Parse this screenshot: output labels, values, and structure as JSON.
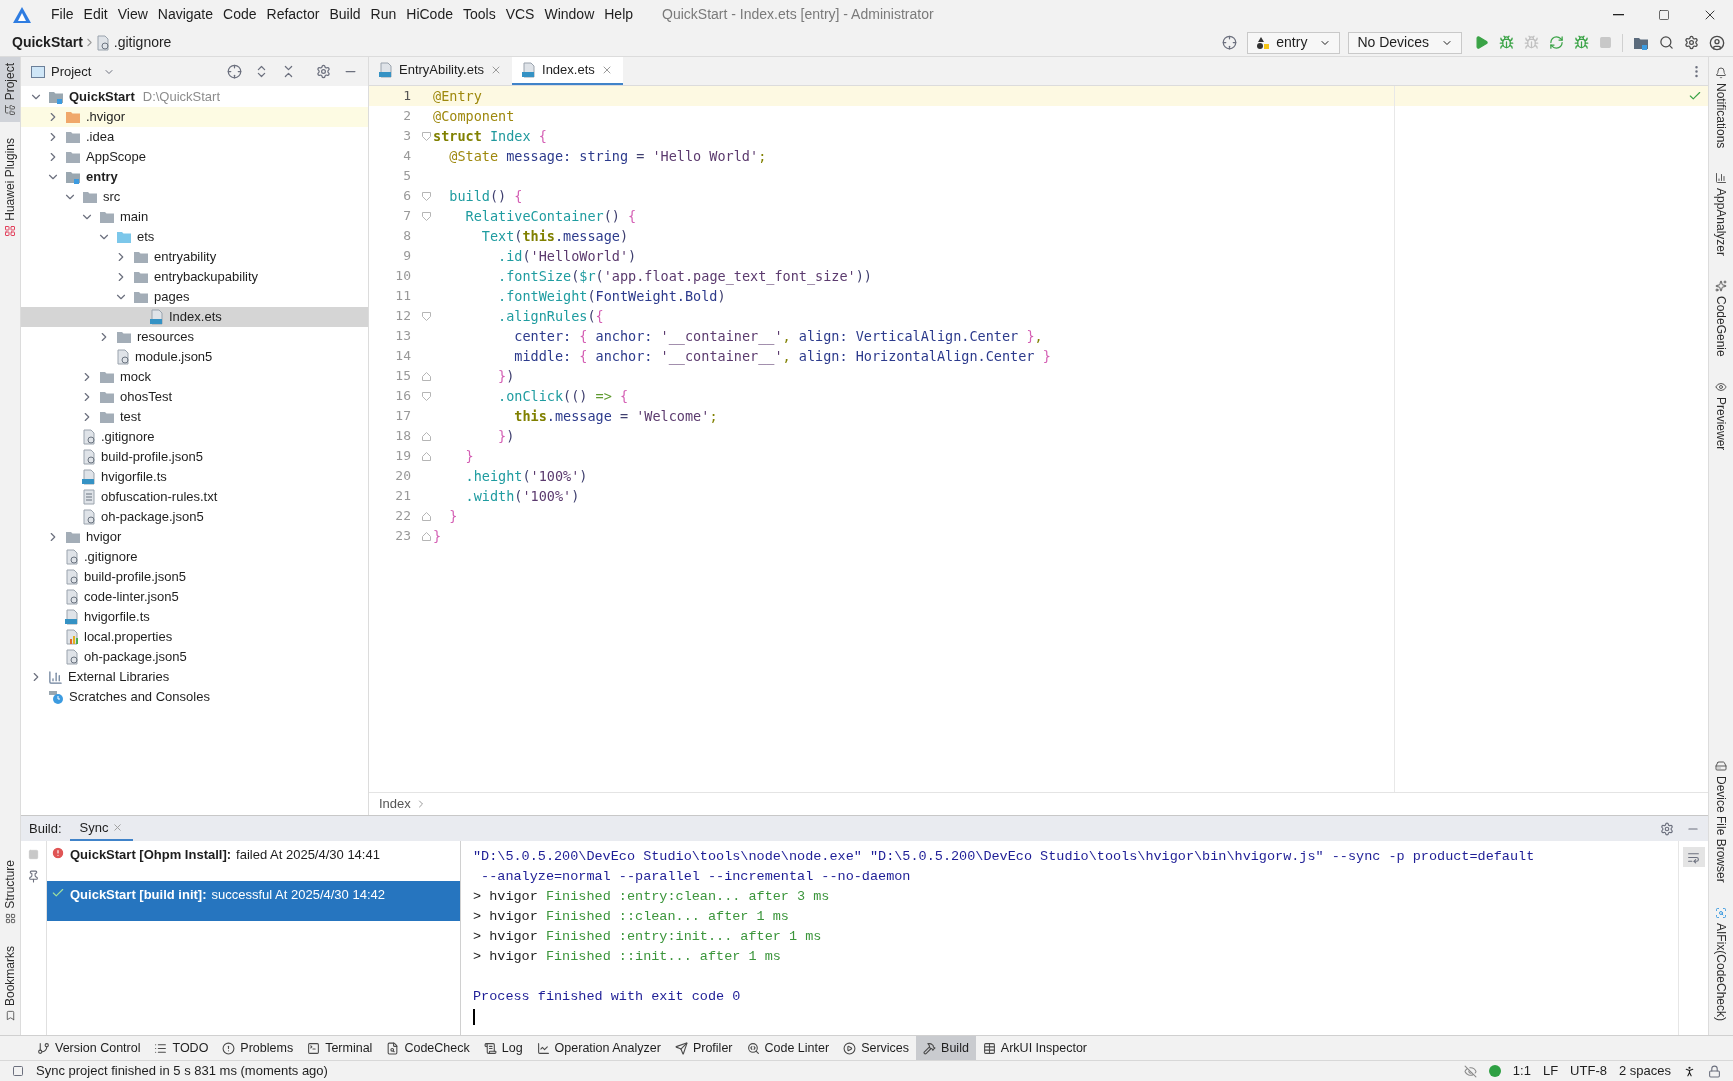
{
  "window": {
    "title": "QuickStart - Index.ets [entry] - Administrator"
  },
  "menu": [
    "File",
    "Edit",
    "View",
    "Navigate",
    "Code",
    "Refactor",
    "Build",
    "Run",
    "HiCode",
    "Tools",
    "VCS",
    "Window",
    "Help"
  ],
  "navbar": {
    "project": "QuickStart",
    "file": ".gitignore",
    "module_selector": "entry",
    "device_selector": "No Devices"
  },
  "left_stripe": {
    "top": [
      {
        "label": "Project",
        "selected": true
      },
      {
        "label": "Huawei Plugins",
        "selected": false
      }
    ],
    "bottom": [
      {
        "label": "Structure",
        "selected": false
      },
      {
        "label": "Bookmarks",
        "selected": false
      }
    ]
  },
  "right_stripe": {
    "top": [
      "Notifications",
      "AppAnalyzer",
      "CodeGenie",
      "Previewer"
    ],
    "bottom": [
      "Device File Browser",
      "AIFix(CodeCheck)"
    ]
  },
  "project_panel": {
    "title": "Project",
    "tree": [
      {
        "label": "QuickStart",
        "path": "D:\\QuickStart",
        "kind": "module",
        "expanded": true,
        "selected": false,
        "highlighted": false,
        "children": [
          {
            "label": ".hvigor",
            "kind": "folder-excluded",
            "expanded": false,
            "selected": false,
            "highlighted": true
          },
          {
            "label": ".idea",
            "kind": "folder",
            "expanded": false,
            "selected": false,
            "highlighted": false
          },
          {
            "label": "AppScope",
            "kind": "folder",
            "expanded": false,
            "selected": false,
            "highlighted": false
          },
          {
            "label": "entry",
            "kind": "module",
            "expanded": true,
            "selected": false,
            "highlighted": false,
            "children": [
              {
                "label": "src",
                "kind": "folder",
                "expanded": true,
                "selected": false,
                "highlighted": false,
                "children": [
                  {
                    "label": "main",
                    "kind": "folder",
                    "expanded": true,
                    "selected": false,
                    "highlighted": false,
                    "children": [
                      {
                        "label": "ets",
                        "kind": "folder-source",
                        "expanded": true,
                        "selected": false,
                        "highlighted": false,
                        "children": [
                          {
                            "label": "entryability",
                            "kind": "folder",
                            "expanded": false,
                            "selected": false,
                            "highlighted": false
                          },
                          {
                            "label": "entrybackupability",
                            "kind": "folder",
                            "expanded": false,
                            "selected": false,
                            "highlighted": false
                          },
                          {
                            "label": "pages",
                            "kind": "folder",
                            "expanded": true,
                            "selected": false,
                            "highlighted": false,
                            "children": [
                              {
                                "label": "Index.ets",
                                "kind": "file-ets",
                                "selected": true,
                                "highlighted": false
                              }
                            ]
                          }
                        ]
                      },
                      {
                        "label": "resources",
                        "kind": "folder",
                        "expanded": false,
                        "selected": false,
                        "highlighted": false
                      },
                      {
                        "label": "module.json5",
                        "kind": "file-json",
                        "selected": false,
                        "highlighted": false
                      }
                    ]
                  },
                  {
                    "label": "mock",
                    "kind": "folder",
                    "expanded": false,
                    "selected": false,
                    "highlighted": false
                  },
                  {
                    "label": "ohosTest",
                    "kind": "folder",
                    "expanded": false,
                    "selected": false,
                    "highlighted": false
                  },
                  {
                    "label": "test",
                    "kind": "folder",
                    "expanded": false,
                    "selected": false,
                    "highlighted": false
                  }
                ]
              },
              {
                "label": ".gitignore",
                "kind": "file-ignore",
                "selected": false,
                "highlighted": false
              },
              {
                "label": "build-profile.json5",
                "kind": "file-json",
                "selected": false,
                "highlighted": false
              },
              {
                "label": "hvigorfile.ts",
                "kind": "file-ts",
                "selected": false,
                "highlighted": false
              },
              {
                "label": "obfuscation-rules.txt",
                "kind": "file-text",
                "selected": false,
                "highlighted": false
              },
              {
                "label": "oh-package.json5",
                "kind": "file-json",
                "selected": false,
                "highlighted": false
              }
            ]
          },
          {
            "label": "hvigor",
            "kind": "folder",
            "expanded": false,
            "selected": false,
            "highlighted": false
          },
          {
            "label": ".gitignore",
            "kind": "file-ignore",
            "selected": false,
            "highlighted": false
          },
          {
            "label": "build-profile.json5",
            "kind": "file-json",
            "selected": false,
            "highlighted": false
          },
          {
            "label": "code-linter.json5",
            "kind": "file-json",
            "selected": false,
            "highlighted": false
          },
          {
            "label": "hvigorfile.ts",
            "kind": "file-ts",
            "selected": false,
            "highlighted": false
          },
          {
            "label": "local.properties",
            "kind": "file-props",
            "selected": false,
            "highlighted": false
          },
          {
            "label": "oh-package.json5",
            "kind": "file-json",
            "selected": false,
            "highlighted": false
          }
        ]
      },
      {
        "label": "External Libraries",
        "kind": "libraries",
        "expanded": false,
        "selected": false,
        "highlighted": false
      },
      {
        "label": "Scratches and Consoles",
        "kind": "scratches",
        "selected": false,
        "highlighted": false
      }
    ]
  },
  "editor": {
    "tabs": [
      {
        "label": "EntryAbility.ets",
        "selected": false
      },
      {
        "label": "Index.ets",
        "selected": true
      }
    ],
    "lines": [
      {
        "number": "1",
        "kind": "plain",
        "current": true,
        "tokens": [
          {
            "t": "@Entry",
            "kind": "annotation"
          }
        ]
      },
      {
        "number": "2",
        "kind": "plain",
        "current": false,
        "tokens": [
          {
            "t": "@Component",
            "kind": "annotation"
          }
        ]
      },
      {
        "number": "3",
        "kind": "fold-start",
        "current": false,
        "tokens": [
          {
            "t": "struct",
            "kind": "keyword"
          },
          {
            "t": " Index ",
            "kind": "type"
          },
          {
            "t": "{",
            "kind": "brace"
          }
        ]
      },
      {
        "number": "4",
        "kind": "plain",
        "current": false,
        "tokens": [
          {
            "t": "  @State",
            "kind": "annotation"
          },
          {
            "t": " message: string ",
            "kind": "ident"
          },
          {
            "t": "= ",
            "kind": "plain"
          },
          {
            "t": "'Hello World'",
            "kind": "string"
          },
          {
            "t": ";",
            "kind": "semi"
          }
        ]
      },
      {
        "number": "5",
        "kind": "plain",
        "current": false
      },
      {
        "number": "6",
        "kind": "fold-start",
        "current": false,
        "tokens": [
          {
            "t": "  build",
            "kind": "fn"
          },
          {
            "t": "() ",
            "kind": "plain"
          },
          {
            "t": "{",
            "kind": "brace"
          }
        ]
      },
      {
        "number": "7",
        "kind": "fold-start",
        "current": false,
        "tokens": [
          {
            "t": "    RelativeContainer",
            "kind": "fn"
          },
          {
            "t": "() ",
            "kind": "plain"
          },
          {
            "t": "{",
            "kind": "brace"
          }
        ]
      },
      {
        "number": "8",
        "kind": "plain",
        "current": false,
        "tokens": [
          {
            "t": "      Text",
            "kind": "fn"
          },
          {
            "t": "(",
            "kind": "plain"
          },
          {
            "t": "this",
            "kind": "keyword"
          },
          {
            "t": ".message",
            "kind": "ident"
          },
          {
            "t": ")",
            "kind": "plain"
          }
        ]
      },
      {
        "number": "9",
        "kind": "plain",
        "current": false,
        "tokens": [
          {
            "t": "        .id",
            "kind": "fn"
          },
          {
            "t": "(",
            "kind": "plain"
          },
          {
            "t": "'HelloWorld'",
            "kind": "string"
          },
          {
            "t": ")",
            "kind": "plain"
          }
        ]
      },
      {
        "number": "10",
        "kind": "plain",
        "current": false,
        "tokens": [
          {
            "t": "        .fontSize",
            "kind": "fn"
          },
          {
            "t": "(",
            "kind": "plain"
          },
          {
            "t": "$r",
            "kind": "fn"
          },
          {
            "t": "(",
            "kind": "plain"
          },
          {
            "t": "'app.float.page_text_font_size'",
            "kind": "string"
          },
          {
            "t": "))",
            "kind": "plain"
          }
        ]
      },
      {
        "number": "11",
        "kind": "plain",
        "current": false,
        "tokens": [
          {
            "t": "        .fontWeight",
            "kind": "fn"
          },
          {
            "t": "(",
            "kind": "plain"
          },
          {
            "t": "FontWeight.Bold",
            "kind": "ident"
          },
          {
            "t": ")",
            "kind": "plain"
          }
        ]
      },
      {
        "number": "12",
        "kind": "fold-start",
        "current": false,
        "tokens": [
          {
            "t": "        .alignRules",
            "kind": "fn"
          },
          {
            "t": "(",
            "kind": "plain"
          },
          {
            "t": "{",
            "kind": "brace"
          }
        ]
      },
      {
        "number": "13",
        "kind": "plain",
        "current": false,
        "tokens": [
          {
            "t": "          center: ",
            "kind": "ident"
          },
          {
            "t": "{ ",
            "kind": "brace"
          },
          {
            "t": "anchor: ",
            "kind": "ident"
          },
          {
            "t": "'__container__'",
            "kind": "string"
          },
          {
            "t": ", ",
            "kind": "semi"
          },
          {
            "t": "align: VerticalAlign.Center ",
            "kind": "ident"
          },
          {
            "t": "}",
            "kind": "brace"
          },
          {
            "t": ",",
            "kind": "semi"
          }
        ]
      },
      {
        "number": "14",
        "kind": "plain",
        "current": false,
        "tokens": [
          {
            "t": "          middle: ",
            "kind": "ident"
          },
          {
            "t": "{ ",
            "kind": "brace"
          },
          {
            "t": "anchor: ",
            "kind": "ident"
          },
          {
            "t": "'__container__'",
            "kind": "string"
          },
          {
            "t": ", ",
            "kind": "semi"
          },
          {
            "t": "align: HorizontalAlign.Center ",
            "kind": "ident"
          },
          {
            "t": "}",
            "kind": "brace"
          }
        ]
      },
      {
        "number": "15",
        "kind": "fold-end",
        "current": false,
        "tokens": [
          {
            "t": "        }",
            "kind": "brace"
          },
          {
            "t": ")",
            "kind": "plain"
          }
        ]
      },
      {
        "number": "16",
        "kind": "fold-start",
        "current": false,
        "tokens": [
          {
            "t": "        .onClick",
            "kind": "fn"
          },
          {
            "t": "(() ",
            "kind": "plain"
          },
          {
            "t": "=> ",
            "kind": "arrow"
          },
          {
            "t": "{",
            "kind": "brace"
          }
        ]
      },
      {
        "number": "17",
        "kind": "plain",
        "current": false,
        "tokens": [
          {
            "t": "          this",
            "kind": "keyword"
          },
          {
            "t": ".message ",
            "kind": "ident"
          },
          {
            "t": "= ",
            "kind": "plain"
          },
          {
            "t": "'Welcome'",
            "kind": "string"
          },
          {
            "t": ";",
            "kind": "semi"
          }
        ]
      },
      {
        "number": "18",
        "kind": "fold-end",
        "current": false,
        "tokens": [
          {
            "t": "        }",
            "kind": "brace"
          },
          {
            "t": ")",
            "kind": "plain"
          }
        ]
      },
      {
        "number": "19",
        "kind": "fold-end",
        "current": false,
        "tokens": [
          {
            "t": "    }",
            "kind": "brace"
          }
        ]
      },
      {
        "number": "20",
        "kind": "plain",
        "current": false,
        "tokens": [
          {
            "t": "    .height",
            "kind": "fn"
          },
          {
            "t": "(",
            "kind": "plain"
          },
          {
            "t": "'100%'",
            "kind": "string"
          },
          {
            "t": ")",
            "kind": "plain"
          }
        ]
      },
      {
        "number": "21",
        "kind": "plain",
        "current": false,
        "tokens": [
          {
            "t": "    .width",
            "kind": "fn"
          },
          {
            "t": "(",
            "kind": "plain"
          },
          {
            "t": "'100%'",
            "kind": "string"
          },
          {
            "t": ")",
            "kind": "plain"
          }
        ]
      },
      {
        "number": "22",
        "kind": "fold-end",
        "current": false,
        "tokens": [
          {
            "t": "  }",
            "kind": "brace"
          }
        ]
      },
      {
        "number": "23",
        "kind": "fold-end",
        "current": false,
        "tokens": [
          {
            "t": "}",
            "kind": "brace"
          }
        ]
      }
    ],
    "breadcrumb": "Index"
  },
  "build_panel": {
    "label": "Build:",
    "tabs": [
      {
        "label": "Sync",
        "selected": true
      }
    ],
    "events": [
      {
        "kind": "error",
        "title": "QuickStart [Ohpm Install]:",
        "detail": "failed At 2025/4/30 14:41",
        "selected": false
      },
      {
        "kind": "success",
        "title": "QuickStart [build init]:",
        "detail": "successful At 2025/4/30 14:42",
        "selected": true
      }
    ],
    "console": [
      {
        "kind": "command",
        "tokens": [
          {
            "t": "\"D:\\5.0.5.200\\DevEco Studio\\tools\\node\\node.exe\" \"D:\\5.0.5.200\\DevEco Studio\\tools\\hvigor\\bin\\hvigorw.js\" --sync -p product=default",
            "kind": "command"
          }
        ]
      },
      {
        "kind": "command",
        "tokens": [
          {
            "t": " --analyze=normal --parallel --incremental --no-daemon",
            "kind": "command"
          }
        ]
      },
      {
        "kind": "output",
        "tokens": [
          {
            "t": "> hvigor ",
            "kind": "plain"
          },
          {
            "t": "Finished :entry:clean... after 3 ms",
            "kind": "success"
          }
        ]
      },
      {
        "kind": "output",
        "tokens": [
          {
            "t": "> hvigor ",
            "kind": "plain"
          },
          {
            "t": "Finished ::clean... after 1 ms",
            "kind": "success"
          }
        ]
      },
      {
        "kind": "output",
        "tokens": [
          {
            "t": "> hvigor ",
            "kind": "plain"
          },
          {
            "t": "Finished :entry:init... after 1 ms",
            "kind": "success"
          }
        ]
      },
      {
        "kind": "output",
        "tokens": [
          {
            "t": "> hvigor ",
            "kind": "plain"
          },
          {
            "t": "Finished ::init... after 1 ms",
            "kind": "success"
          }
        ]
      },
      {
        "kind": "result",
        "tokens": [
          {
            "t": "Process finished with exit code 0",
            "kind": "command"
          }
        ]
      }
    ]
  },
  "tool_windows": [
    {
      "label": "Version Control",
      "selected": false
    },
    {
      "label": "TODO",
      "selected": false
    },
    {
      "label": "Problems",
      "selected": false
    },
    {
      "label": "Terminal",
      "selected": false
    },
    {
      "label": "CodeCheck",
      "selected": false
    },
    {
      "label": "Log",
      "selected": false
    },
    {
      "label": "Operation Analyzer",
      "selected": false
    },
    {
      "label": "Profiler",
      "selected": false
    },
    {
      "label": "Code Linter",
      "selected": false
    },
    {
      "label": "Services",
      "selected": false
    },
    {
      "label": "Build",
      "selected": true
    },
    {
      "label": "ArkUI Inspector",
      "selected": false
    }
  ],
  "status_bar": {
    "message": "Sync project finished in 5 s 831 ms (moments ago)",
    "position": "1:1",
    "line_separator": "LF",
    "encoding": "UTF-8",
    "indent": "2 spaces"
  }
}
